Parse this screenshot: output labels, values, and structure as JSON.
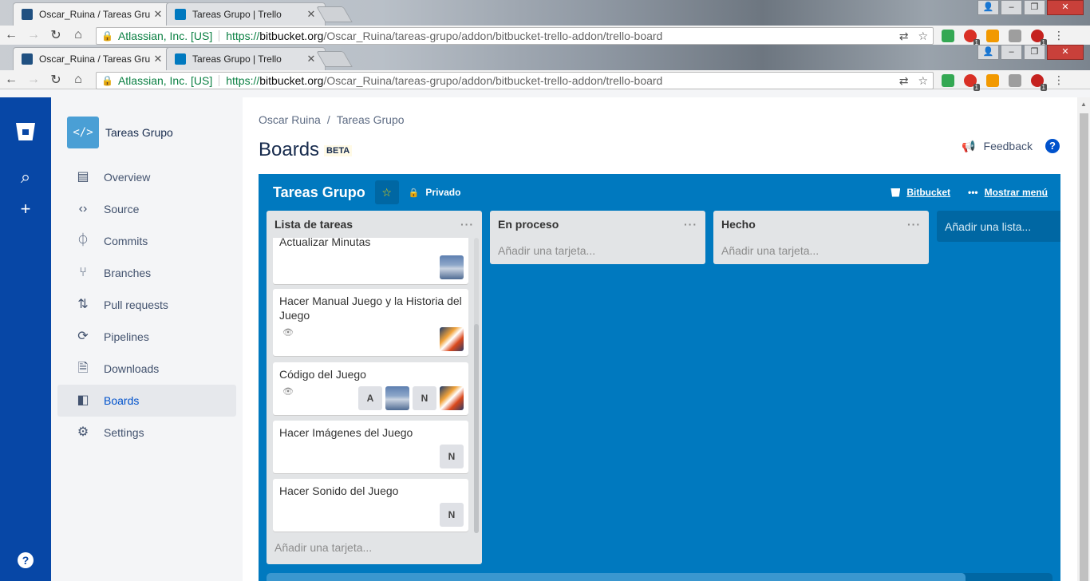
{
  "browser": {
    "tabs": [
      {
        "title": "Oscar_Ruina / Tareas Gru",
        "active": true
      },
      {
        "title": "Tareas Grupo | Trello",
        "active": false
      }
    ],
    "url": {
      "org": "Atlassian, Inc. [US]",
      "protocol": "https://",
      "host": "bitbucket.org",
      "path": "/Oscar_Ruina/tareas-grupo/addon/bitbucket-trello-addon/trello-board"
    },
    "extension_badges": [
      "1",
      "1"
    ]
  },
  "project": {
    "avatar_text": "</>",
    "name": "Tareas Grupo"
  },
  "sidebar": {
    "items": [
      {
        "label": "Overview",
        "icon": "overview-icon"
      },
      {
        "label": "Source",
        "icon": "source-icon"
      },
      {
        "label": "Commits",
        "icon": "commits-icon"
      },
      {
        "label": "Branches",
        "icon": "branches-icon"
      },
      {
        "label": "Pull requests",
        "icon": "pull-requests-icon"
      },
      {
        "label": "Pipelines",
        "icon": "pipelines-icon"
      },
      {
        "label": "Downloads",
        "icon": "downloads-icon"
      },
      {
        "label": "Boards",
        "icon": "boards-icon",
        "active": true
      },
      {
        "label": "Settings",
        "icon": "settings-icon"
      }
    ]
  },
  "main": {
    "breadcrumb": [
      "Oscar Ruina",
      "Tareas Grupo"
    ],
    "title": "Boards",
    "badge": "BETA",
    "feedback": "Feedback"
  },
  "board": {
    "name": "Tareas Grupo",
    "visibility": "Privado",
    "bitbucket_link": "Bitbucket",
    "menu_link": "Mostrar menú",
    "lists": [
      {
        "title": "Lista de tareas",
        "add_card": "Añadir una tarjeta...",
        "cards": [
          {
            "title": "Actualizar Minutas",
            "members": [
              "pic1"
            ]
          },
          {
            "title": "Hacer Manual Juego y la Historia del Juego",
            "watched": true,
            "members": [
              "pic2"
            ]
          },
          {
            "title": "Código del Juego",
            "watched": true,
            "members": [
              "A",
              "pic1",
              "N",
              "pic2"
            ]
          },
          {
            "title": "Hacer Imágenes del Juego",
            "members": [
              "N"
            ]
          },
          {
            "title": "Hacer Sonido del Juego",
            "members": [
              "N"
            ]
          }
        ]
      },
      {
        "title": "En proceso",
        "add_card": "Añadir una tarjeta...",
        "cards": []
      },
      {
        "title": "Hecho",
        "add_card": "Añadir una tarjeta...",
        "cards": []
      }
    ],
    "add_list": "Añadir una lista...",
    "colors": {
      "board": "#0079bf",
      "list": "#e2e4e6"
    }
  }
}
